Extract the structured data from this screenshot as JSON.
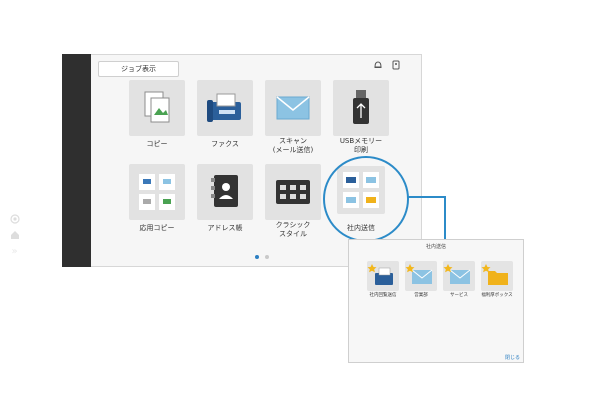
{
  "toolbar": {
    "job_label": "ジョブ表示",
    "bell_icon": "bell-icon",
    "user_icon": "user-device-icon"
  },
  "sidebar": {
    "icons": [
      "settings-icon",
      "home-icon",
      "chevron-right-double-icon"
    ]
  },
  "apps": [
    {
      "label": "コピー"
    },
    {
      "label": "ファクス"
    },
    {
      "label": "スキャン\n(メール送信)"
    },
    {
      "label": "USBメモリー\n印刷"
    },
    {
      "label": "応用コピー"
    },
    {
      "label": "アドレス帳"
    },
    {
      "label": "クラシック\nスタイル"
    },
    {
      "label": "社内送信"
    }
  ],
  "pagination": {
    "current": 1,
    "total": 2
  },
  "popup": {
    "title": "社内送信",
    "items": [
      {
        "label": "社内回覧送信"
      },
      {
        "label": "営業部"
      },
      {
        "label": "サービス"
      },
      {
        "label": "福利厚ボックス"
      }
    ],
    "close_label": "閉じる"
  },
  "colors": {
    "accent": "#2c8bc8",
    "sidebar": "#2f2f2f",
    "star": "#f2b71d",
    "folder": "#f0b21b",
    "mail": "#8cc3e3"
  }
}
